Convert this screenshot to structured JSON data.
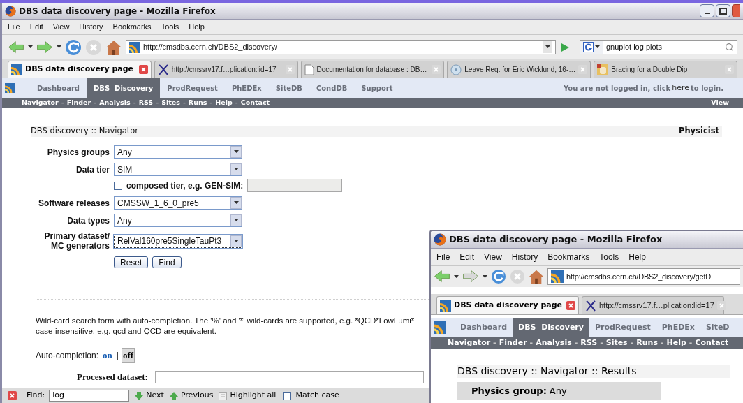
{
  "main_window": {
    "title": "DBS data discovery page - Mozilla Firefox",
    "menu": [
      "File",
      "Edit",
      "View",
      "History",
      "Bookmarks",
      "Tools",
      "Help"
    ],
    "url": "http://cmsdbs.cern.ch/DBS2_discovery/",
    "search": {
      "value": "gnuplot log plots"
    },
    "tabs": [
      {
        "label": "DBS data discovery page",
        "selected": true
      },
      {
        "label": "http://cmssrv17.f…plication:lid=17",
        "selected": false
      },
      {
        "label": "Documentation for database : DB…",
        "selected": false
      },
      {
        "label": "Leave Req. for Eric Wicklund, 16-…",
        "selected": false
      },
      {
        "label": "Bracing for a Double Dip",
        "selected": false
      }
    ],
    "site_nav": [
      {
        "label": "Dashboard",
        "selected": false
      },
      {
        "label": "DBS  Discovery",
        "selected": true
      },
      {
        "label": "ProdRequest",
        "selected": false
      },
      {
        "label": "PhEDEx",
        "selected": false
      },
      {
        "label": "SiteDB",
        "selected": false
      },
      {
        "label": "CondDB",
        "selected": false
      },
      {
        "label": "Support",
        "selected": false
      }
    ],
    "login": {
      "before": "You are not logged in, click ",
      "link": "here",
      "after": " to login."
    },
    "sub_nav": {
      "items": [
        "Navigator",
        "Finder",
        "Analysis",
        "RSS",
        "Sites",
        "Runs",
        "Help",
        "Contact"
      ],
      "separator": "-"
    },
    "view_link": "View",
    "page": {
      "heading": "DBS discovery :: Navigator",
      "role": "Physicist",
      "fields": [
        {
          "kind": "select",
          "label": [
            "Physics groups"
          ],
          "value": "Any",
          "focused": false
        },
        {
          "kind": "select",
          "label": [
            "Data tier"
          ],
          "value": "SIM",
          "focused": false
        },
        {
          "kind": "checkbox",
          "label": [
            "composed tier, e.g. GEN-SIM:"
          ],
          "checked": false
        },
        {
          "kind": "select",
          "label": [
            "Software releases"
          ],
          "value": "CMSSW_1_6_0_pre5",
          "focused": false
        },
        {
          "kind": "select",
          "label": [
            "Data types"
          ],
          "value": "Any",
          "focused": false
        },
        {
          "kind": "select",
          "label": [
            "Primary dataset/",
            "MC generators"
          ],
          "value": "RelVal160pre5SingleTauPt3",
          "focused": true
        }
      ],
      "buttons": [
        "Reset",
        "Find"
      ],
      "description": [
        "Wild-card search form with auto-completion. The '%' and '*' wild-cards are supported, e.g. *QCD*LowLumi*",
        "case-insensitive, e.g. qcd and QCD are equivalent."
      ],
      "autocompletion": {
        "label": "Auto-completion:",
        "separator": "|",
        "options": [
          {
            "label": "on",
            "selected": false
          },
          {
            "label": "off",
            "selected": true
          }
        ]
      },
      "processed_dataset": {
        "label": "Processed dataset:"
      }
    },
    "find_bar": {
      "label": "Find:",
      "value": "log",
      "buttons": [
        "Next",
        "Previous",
        "Highlight all"
      ],
      "match_case": {
        "label": "Match case",
        "checked": false
      }
    }
  },
  "second_window": {
    "title": "DBS data discovery page - Mozilla Firefox",
    "menu": [
      "File",
      "Edit",
      "View",
      "History",
      "Bookmarks",
      "Tools",
      "Help"
    ],
    "url": "http://cmsdbs.cern.ch/DBS2_discovery/getD",
    "tabs": [
      {
        "label": "DBS data discovery page",
        "selected": true
      },
      {
        "label": "http://cmssrv17.f…plication:lid=17",
        "selected": false
      }
    ],
    "site_nav": [
      {
        "label": "Dashboard",
        "selected": false
      },
      {
        "label": "DBS  Discovery",
        "selected": true
      },
      {
        "label": "ProdRequest",
        "selected": false
      },
      {
        "label": "PhEDEx",
        "selected": false
      },
      {
        "label": "SiteD",
        "selected": false
      }
    ],
    "sub_nav": {
      "items": [
        "Navigator",
        "Finder",
        "Analysis",
        "RSS",
        "Sites",
        "Runs",
        "Help",
        "Contact"
      ],
      "separator": "-"
    },
    "heading": "DBS discovery :: Navigator :: Results",
    "results": [
      {
        "label": "Physics group:",
        "value": "Any"
      }
    ]
  }
}
